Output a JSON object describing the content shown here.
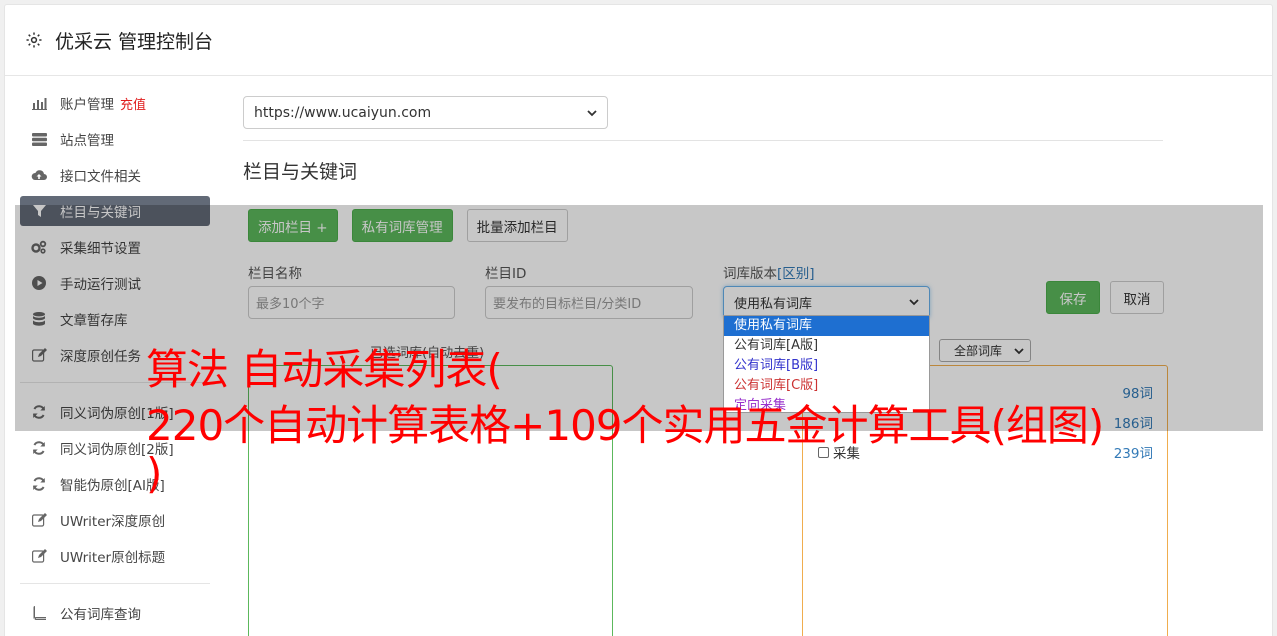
{
  "app": {
    "title": "优采云 管理控制台",
    "icon": "gear-icon"
  },
  "sidebar": {
    "items": [
      {
        "label": "账户管理",
        "badge": "充值",
        "icon": "bar-chart-icon"
      },
      {
        "label": "站点管理",
        "icon": "server-icon"
      },
      {
        "label": "接口文件相关",
        "icon": "cloud-upload-icon"
      },
      {
        "label": "栏目与关键词",
        "icon": "filter-icon",
        "active": true
      },
      {
        "label": "采集细节设置",
        "icon": "cogs-icon"
      },
      {
        "label": "手动运行测试",
        "icon": "play-circle-icon"
      },
      {
        "label": "文章暂存库",
        "icon": "database-icon"
      },
      {
        "label": "深度原创任务",
        "icon": "edit-icon"
      },
      {
        "label": "同义词伪原创[1版]",
        "icon": "refresh-icon"
      },
      {
        "label": "同义词伪原创[2版]",
        "icon": "refresh-icon"
      },
      {
        "label": "智能伪原创[AI版]",
        "icon": "refresh-icon"
      },
      {
        "label": "UWriter深度原创",
        "icon": "edit-icon"
      },
      {
        "label": "UWriter原创标题",
        "icon": "edit-icon"
      },
      {
        "label": "公有词库查询",
        "icon": "book-icon"
      }
    ]
  },
  "main": {
    "site_select": "https://www.ucaiyun.com",
    "section_title": "栏目与关键词",
    "buttons": {
      "add_column": "添加栏目 +",
      "private_lib": "私有词库管理",
      "batch_add": "批量添加栏目"
    },
    "form": {
      "column_name_label": "栏目名称",
      "column_name_placeholder": "最多10个字",
      "column_id_label": "栏目ID",
      "column_id_placeholder": "要发布的目标栏目/分类ID",
      "lib_version_label": "词库版本",
      "lib_version_link": "[区别]",
      "lib_version_value": "使用私有词库",
      "save": "保存",
      "cancel": "取消"
    },
    "dropdown_options": [
      {
        "label": "使用私有词库",
        "color": "#ffffff"
      },
      {
        "label": "公有词库[A版]",
        "color": "#333333"
      },
      {
        "label": "公有词库[B版]",
        "color": "#3333cc"
      },
      {
        "label": "公有词库[C版]",
        "color": "#cc3333"
      },
      {
        "label": "定向采集",
        "color": "#9933cc"
      }
    ],
    "selected_caption": "已选词库(自动去重)",
    "lib_filter": "全部词库",
    "libs": [
      {
        "name": "",
        "count": "98词"
      },
      {
        "name": "",
        "count": "186词"
      },
      {
        "name": "采集",
        "count": "239词"
      }
    ]
  },
  "promo": {
    "line1": "算法 自动采集列表(",
    "line2": "220个自动计算表格+109个实用五金计算工具(组图)",
    "line3": ")"
  }
}
